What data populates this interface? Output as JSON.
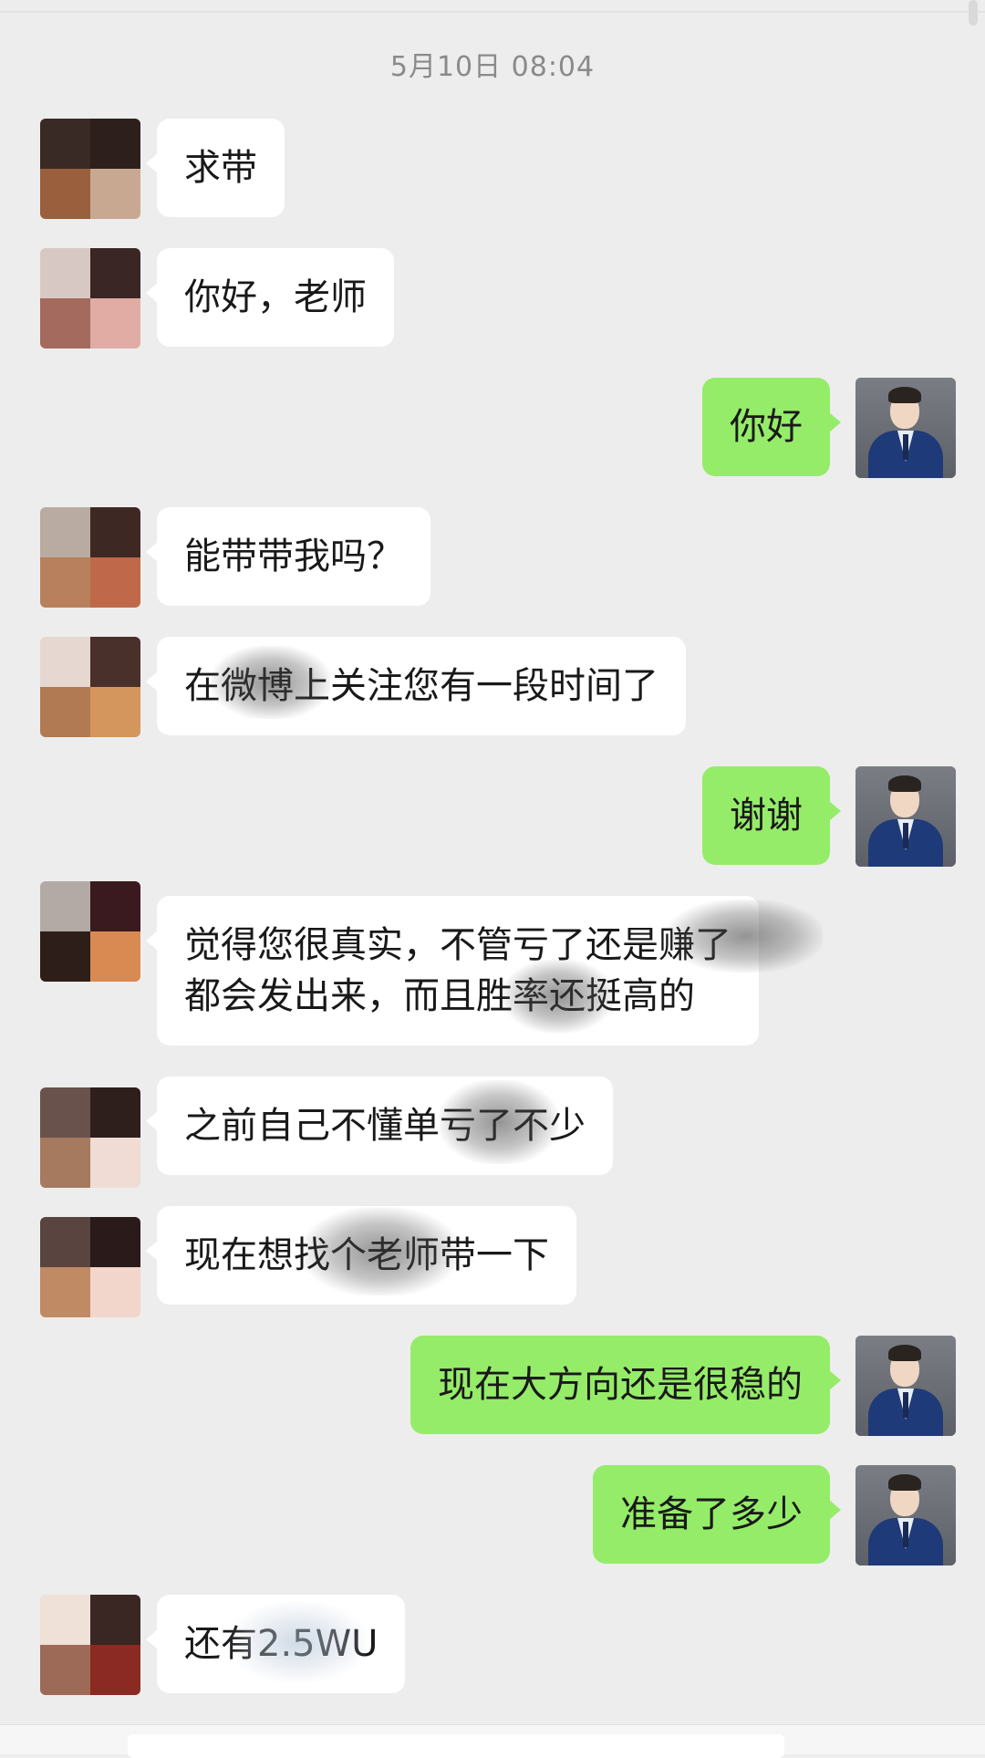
{
  "timestamp": "5月10日 08:04",
  "colors": {
    "background": "#ededed",
    "incoming_bubble": "#ffffff",
    "outgoing_bubble": "#95ec69",
    "text": "#191919"
  },
  "messages": [
    {
      "side": "left",
      "text": "求带"
    },
    {
      "side": "left",
      "text": "你好，老师"
    },
    {
      "side": "right",
      "text": "你好"
    },
    {
      "side": "left",
      "text": "能带带我吗？"
    },
    {
      "side": "left",
      "text": "在微博上关注您有一段时间了"
    },
    {
      "side": "right",
      "text": "谢谢"
    },
    {
      "side": "left",
      "line1": "觉得您很真实，不管亏了还是赚了",
      "line2": "都会发出来，而且胜率还挺高的"
    },
    {
      "side": "left",
      "text": "之前自己不懂单亏了不少"
    },
    {
      "side": "left",
      "text": "现在想找个老师带一下"
    },
    {
      "side": "right",
      "text": "现在大方向还是很稳的"
    },
    {
      "side": "right",
      "text": "准备了多少"
    },
    {
      "side": "left",
      "text": "还有2.5WU"
    }
  ]
}
